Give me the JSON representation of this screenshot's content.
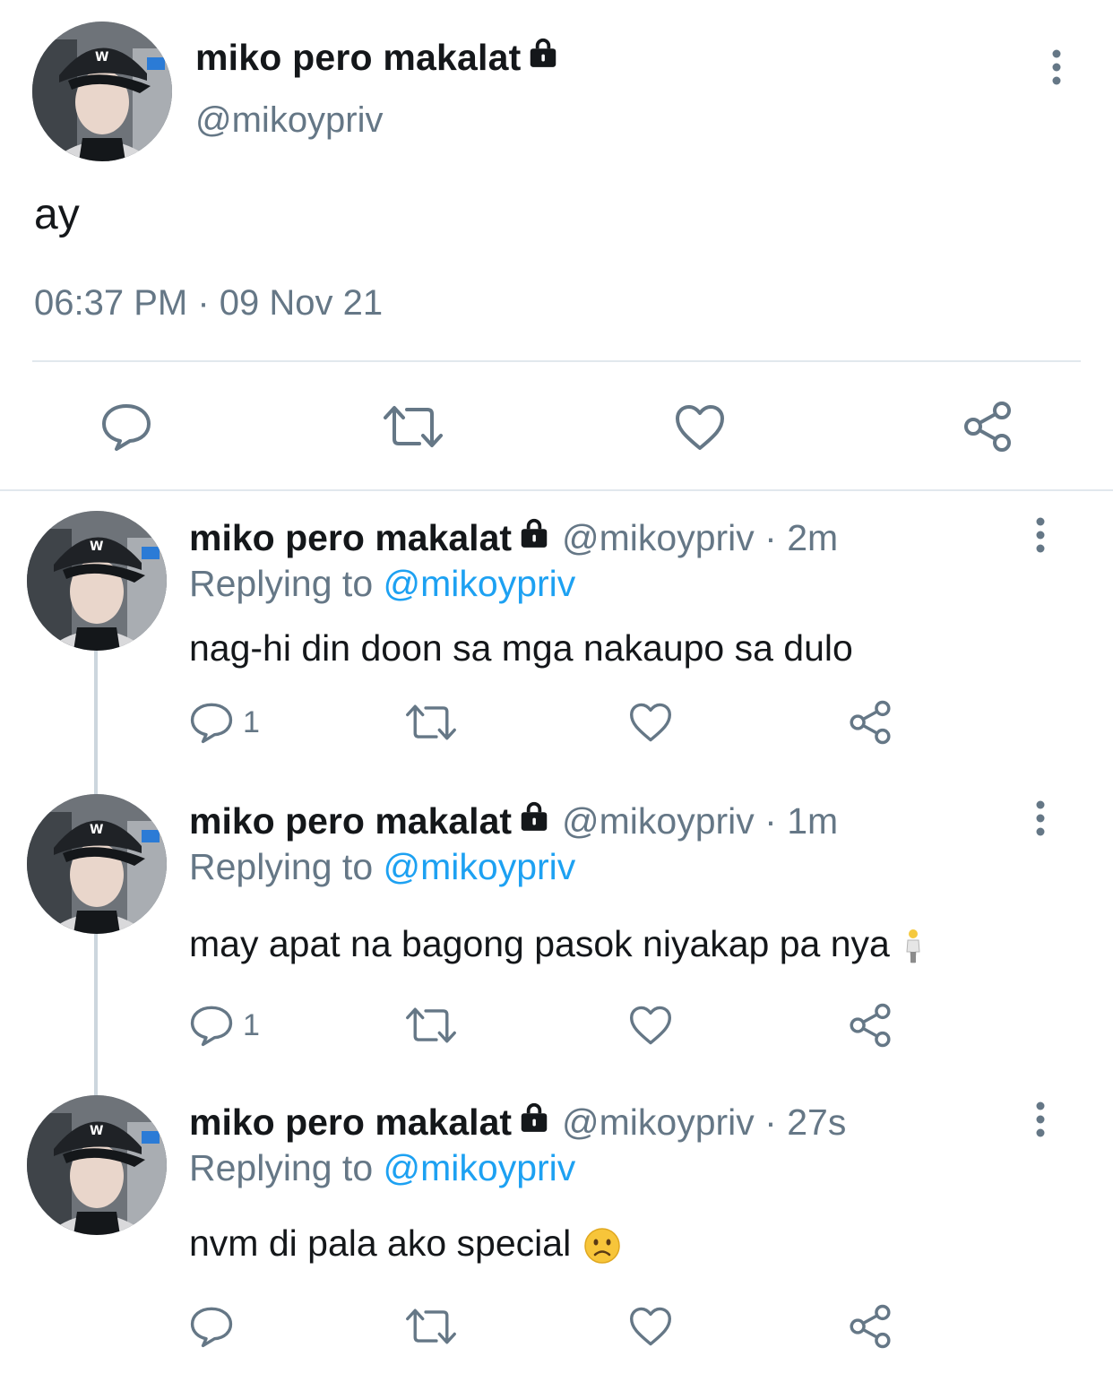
{
  "main_tweet": {
    "display_name": "miko pero makalat",
    "handle": "@mikoypriv",
    "text": "ay",
    "timestamp": "06:37 PM · 09 Nov 21",
    "actions": [
      "reply-icon",
      "retweet-icon",
      "like-icon",
      "share-icon"
    ]
  },
  "replies": [
    {
      "display_name": "miko pero makalat",
      "meta": "@mikoypriv · 2m",
      "replying_prefix": "Replying to",
      "replying_handle": "@mikoypriv",
      "text": "nag-hi din doon sa mga nakaupo sa dulo",
      "reply_count": "1"
    },
    {
      "display_name": "miko pero makalat",
      "meta": "@mikoypriv · 1m",
      "replying_prefix": "Replying to",
      "replying_handle": "@mikoypriv",
      "text": "may apat na bagong pasok niyakap pa nya",
      "emoji": "person-standing-emoji",
      "reply_count": "1"
    },
    {
      "display_name": "miko pero makalat",
      "meta": "@mikoypriv · 27s",
      "replying_prefix": "Replying to",
      "replying_handle": "@mikoypriv",
      "text": "nvm di pala ako special",
      "emoji": "slightly-frowning-face-emoji",
      "reply_count": ""
    }
  ],
  "colors": {
    "text": "#14171a",
    "secondary": "#657786",
    "link": "#1da1f2",
    "divider": "#e1e8ed",
    "thread_line": "#ccd6dd"
  }
}
